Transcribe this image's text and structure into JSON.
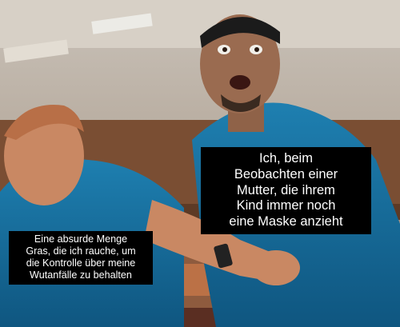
{
  "meme": {
    "caption_right": {
      "lines": [
        "Ich, beim",
        "Beobachten einer",
        "Mutter, die ihrem",
        "Kind immer noch",
        "eine Maske anzieht"
      ]
    },
    "caption_left": {
      "lines": [
        "Eine absurde Menge",
        "Gras, die ich rauche, um",
        "die Kontrolle über meine",
        "Wutanfälle zu behalten"
      ]
    }
  }
}
